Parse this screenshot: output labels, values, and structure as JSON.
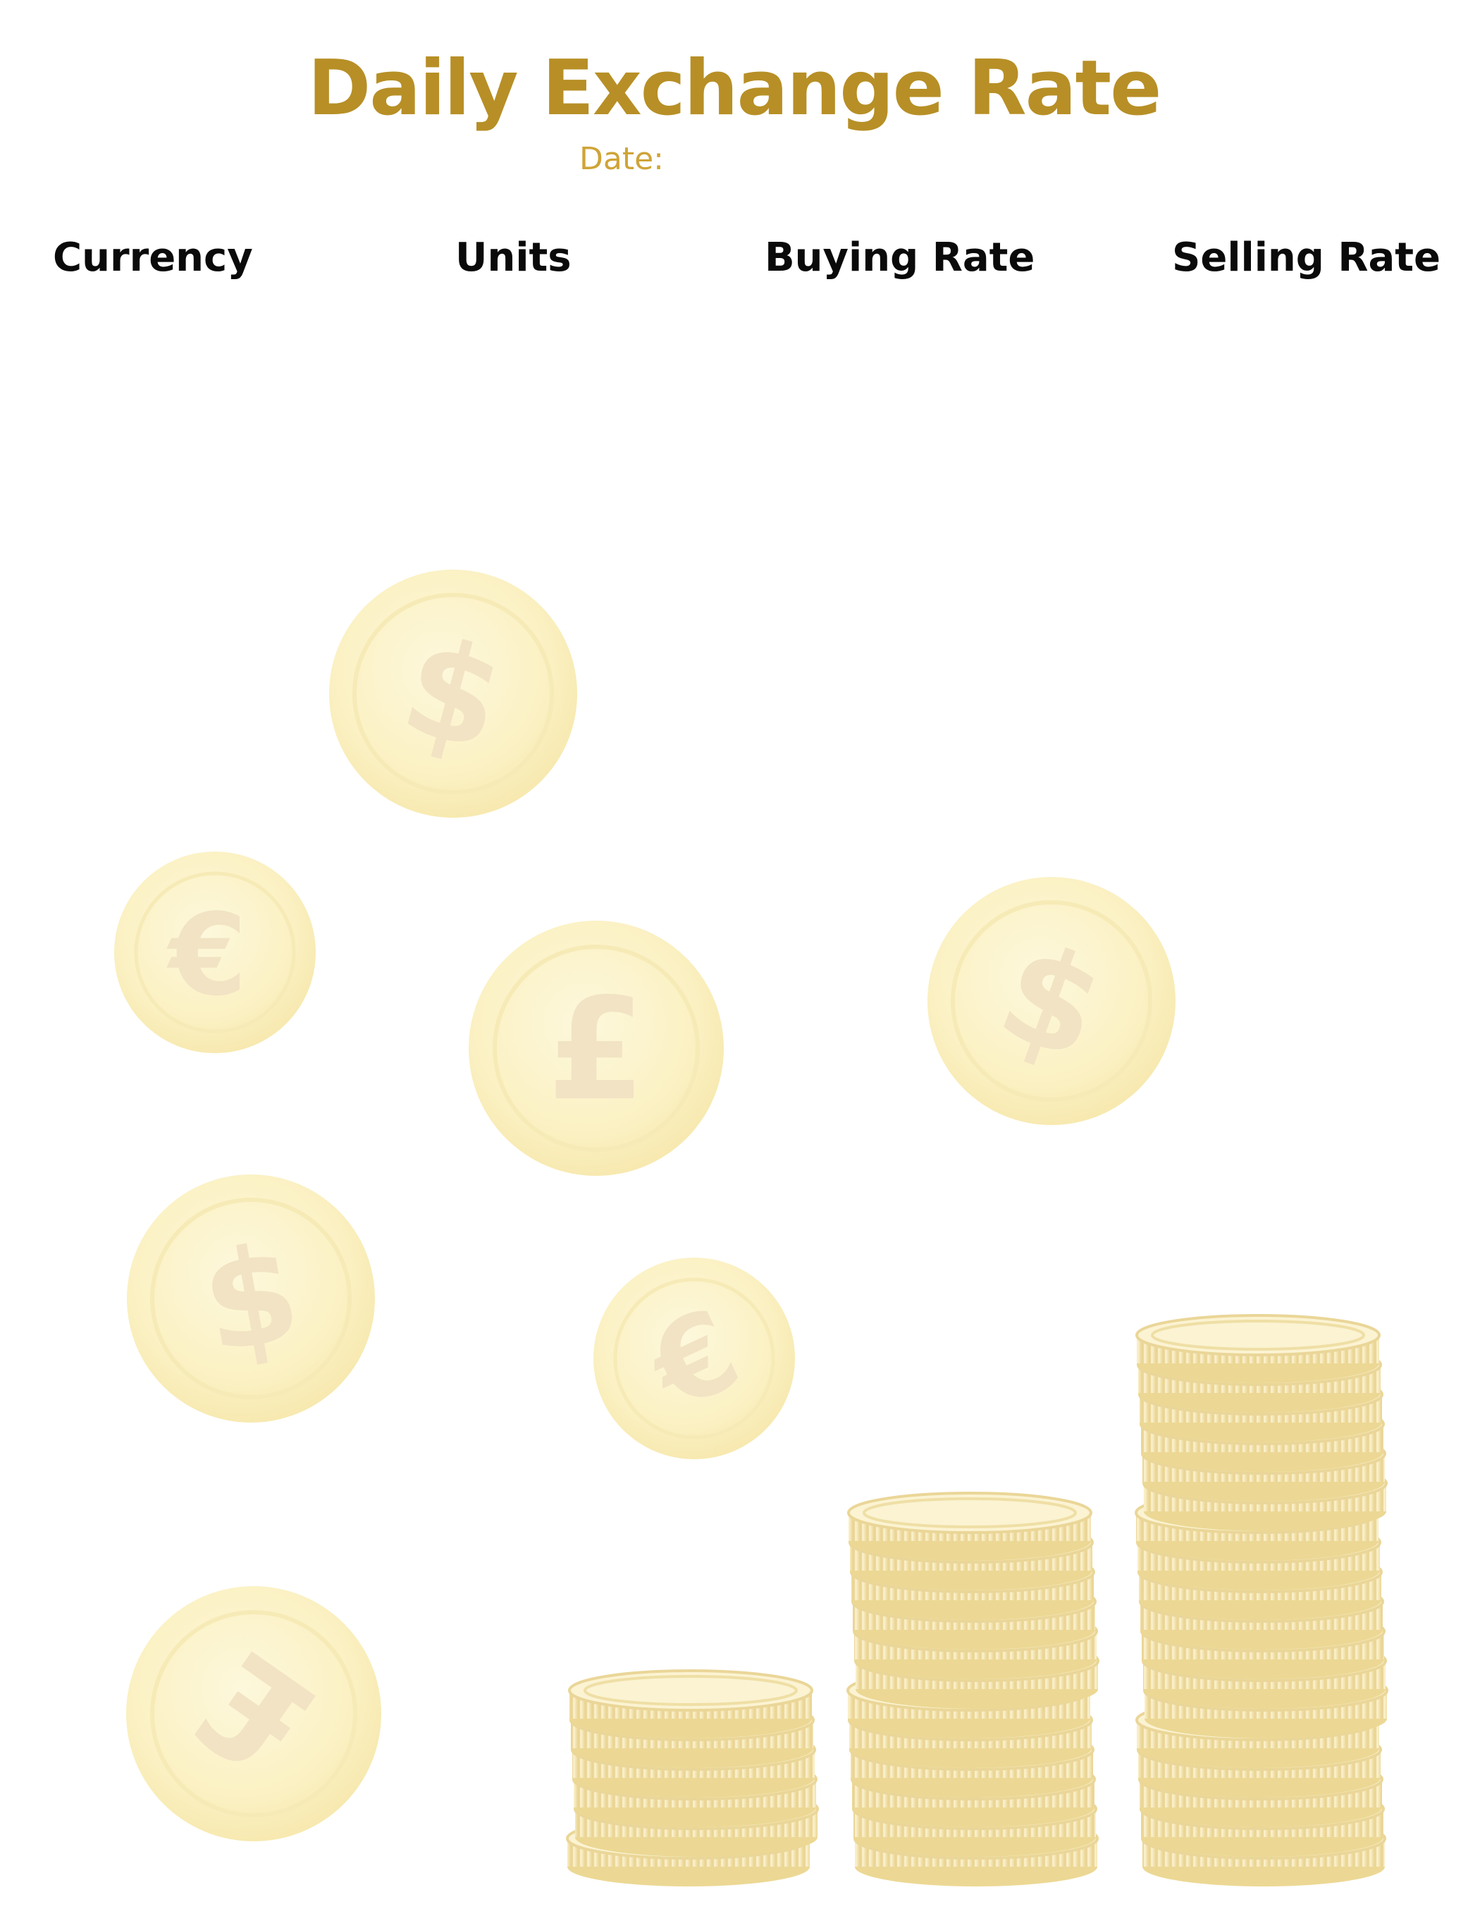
{
  "header": {
    "title": "Daily Exchange Rate",
    "date_label": "Date:"
  },
  "table": {
    "columns": [
      "Currency",
      "Units",
      "Buying Rate",
      "Selling Rate"
    ],
    "rows": []
  },
  "decoration": {
    "coins": [
      {
        "symbol": "$",
        "icon": "dollar-coin-icon"
      },
      {
        "symbol": "€",
        "icon": "euro-coin-icon"
      },
      {
        "symbol": "£",
        "icon": "pound-coin-icon"
      },
      {
        "symbol": "$",
        "icon": "dollar-coin-icon"
      },
      {
        "symbol": "$",
        "icon": "dollar-coin-icon"
      },
      {
        "symbol": "€",
        "icon": "euro-coin-icon"
      },
      {
        "symbol": "£",
        "icon": "pound-coin-icon"
      }
    ],
    "coin_stacks": [
      "coin-stack-icon",
      "coin-stack-icon",
      "coin-stack-icon"
    ],
    "colors": {
      "title": "#b78f26",
      "date": "#cfa437",
      "coin_fill": "#fbf3c9",
      "coin_symbol": "#f1e3c3",
      "stack_fill": "#f3e4a8"
    }
  }
}
